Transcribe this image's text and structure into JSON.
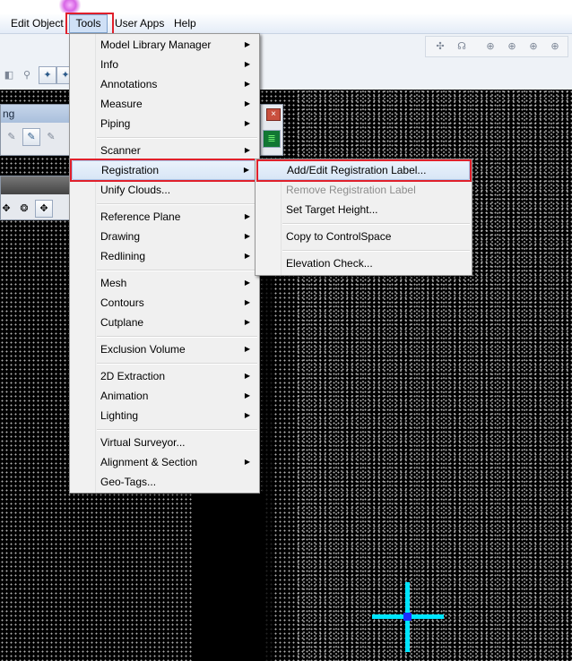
{
  "menubar": {
    "items": [
      {
        "label": "Edit Object"
      },
      {
        "label": "Tools"
      },
      {
        "label": "User Apps"
      },
      {
        "label": "Help"
      }
    ]
  },
  "left_panel": {
    "caption": "ng"
  },
  "tools_menu": {
    "items": [
      {
        "label": "Model Library Manager",
        "submenu": true
      },
      {
        "label": "Info",
        "submenu": true
      },
      {
        "label": "Annotations",
        "submenu": true
      },
      {
        "label": "Measure",
        "submenu": true
      },
      {
        "label": "Piping",
        "submenu": true
      },
      {
        "label": "Scanner",
        "submenu": true
      },
      {
        "label": "Registration",
        "submenu": true
      },
      {
        "label": "Unify Clouds...",
        "submenu": false
      },
      {
        "label": "Reference Plane",
        "submenu": true
      },
      {
        "label": "Drawing",
        "submenu": true
      },
      {
        "label": "Redlining",
        "submenu": true
      },
      {
        "label": "Mesh",
        "submenu": true
      },
      {
        "label": "Contours",
        "submenu": true
      },
      {
        "label": "Cutplane",
        "submenu": true
      },
      {
        "label": "Exclusion Volume",
        "submenu": true
      },
      {
        "label": "2D Extraction",
        "submenu": true
      },
      {
        "label": "Animation",
        "submenu": true
      },
      {
        "label": "Lighting",
        "submenu": true
      },
      {
        "label": "Virtual Surveyor...",
        "submenu": false
      },
      {
        "label": "Alignment & Section",
        "submenu": true
      },
      {
        "label": "Geo-Tags...",
        "submenu": false
      }
    ]
  },
  "registration_submenu": {
    "items": [
      {
        "label": "Add/Edit Registration Label...",
        "enabled": true
      },
      {
        "label": "Remove Registration Label",
        "enabled": false
      },
      {
        "label": "Set Target Height...",
        "enabled": true
      },
      {
        "label": "Copy to ControlSpace",
        "enabled": true
      },
      {
        "label": "Elevation Check...",
        "enabled": true
      }
    ]
  },
  "icons": {
    "submenu_arrow": "▶",
    "close": "×"
  },
  "colors": {
    "highlight_border": "#e0202b",
    "crosshair": "#00e5ff",
    "crosshair_center": "#1b2bff",
    "menu_hot": "#d8e6f6"
  }
}
